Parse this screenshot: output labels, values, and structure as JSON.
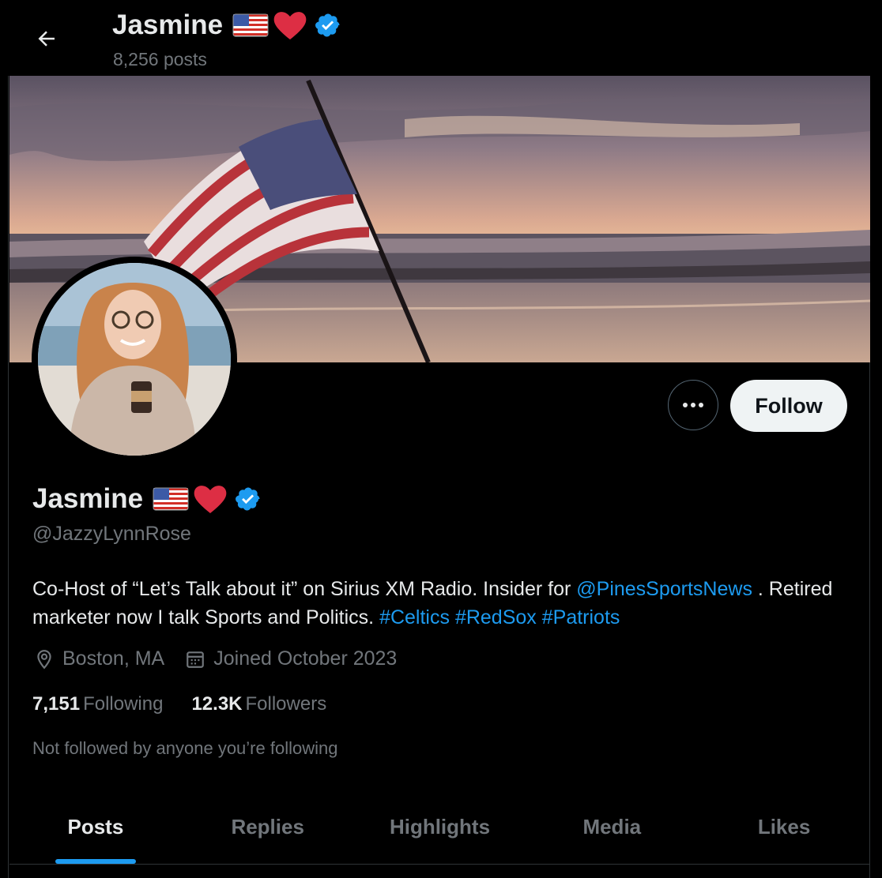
{
  "header": {
    "name": "Jasmine",
    "posts_count": "8,256 posts"
  },
  "profile": {
    "name": "Jasmine",
    "handle": "@JazzyLynnRose",
    "bio_parts": {
      "text1": "Co-Host of “Let’s Talk about it” on Sirius XM Radio. Insider for ",
      "mention": "@PinesSportsNews",
      "text2": " . Retired marketer now I talk Sports and Politics. ",
      "tag1": "#Celtics",
      "tag2": "#RedSox",
      "tag3": "#Patriots"
    },
    "location": "Boston, MA",
    "joined": "Joined October 2023",
    "following_count": "7,151",
    "following_label": "Following",
    "followers_count": "12.3K",
    "followers_label": "Followers",
    "not_followed": "Not followed by anyone you’re following"
  },
  "actions": {
    "follow_label": "Follow"
  },
  "tabs": [
    {
      "label": "Posts",
      "active": true
    },
    {
      "label": "Replies"
    },
    {
      "label": "Highlights"
    },
    {
      "label": "Media"
    },
    {
      "label": "Likes"
    }
  ],
  "icons": {
    "back": "arrow-left-icon",
    "more": "more-horizontal-icon",
    "verified": "verified-badge-icon",
    "location": "location-pin-icon",
    "calendar": "calendar-icon"
  },
  "colors": {
    "accent": "#1d9bf0",
    "muted": "#71767b",
    "text": "#e7e9ea",
    "background": "#000000"
  }
}
